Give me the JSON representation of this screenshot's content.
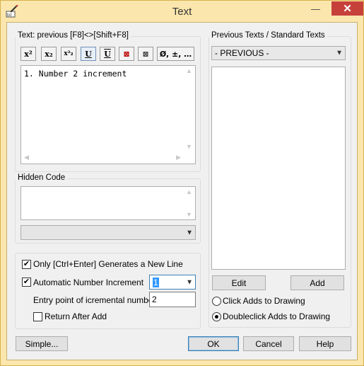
{
  "window": {
    "title": "Text",
    "minimize_glyph": "—",
    "maximize_glyph": "☐",
    "close_glyph": "✕"
  },
  "text_group": {
    "label": "Text: previous [F8]<>[Shift+F8]",
    "format_buttons": [
      {
        "name": "superscript",
        "glyph": "x²"
      },
      {
        "name": "subscript",
        "glyph": "x₂"
      },
      {
        "name": "super-subscript",
        "glyph": "x²₂"
      },
      {
        "name": "underline",
        "glyph": "U"
      },
      {
        "name": "overline",
        "glyph": "U"
      },
      {
        "name": "boxed",
        "glyph": "⊠"
      },
      {
        "name": "strike-box",
        "glyph": "⊠"
      },
      {
        "name": "special-chars",
        "glyph": "Ø, ±, …"
      }
    ],
    "content": "1. Number 2 increment"
  },
  "hidden_code": {
    "label": "Hidden Code",
    "value": "",
    "combo_value": ""
  },
  "options": {
    "only_ctrl_enter_label": "Only [Ctrl+Enter] Generates a New Line",
    "only_ctrl_enter_checked": true,
    "auto_number_label": "Automatic Number Increment",
    "auto_number_checked": true,
    "auto_number_value": "1",
    "entry_point_label": "Entry point of icremental number",
    "entry_point_value": "2",
    "return_after_add_label": "Return After Add",
    "return_after_add_checked": false
  },
  "previous_texts": {
    "label": "Previous Texts / Standard Texts",
    "selected": "- PREVIOUS -",
    "edit_label": "Edit",
    "add_label": "Add",
    "click_adds_label": "Click Adds to Drawing",
    "doubleclick_adds_label": "Doubleclick Adds to Drawing",
    "mode": "doubleclick"
  },
  "footer": {
    "simple_label": "Simple...",
    "ok_label": "OK",
    "cancel_label": "Cancel",
    "help_label": "Help"
  }
}
